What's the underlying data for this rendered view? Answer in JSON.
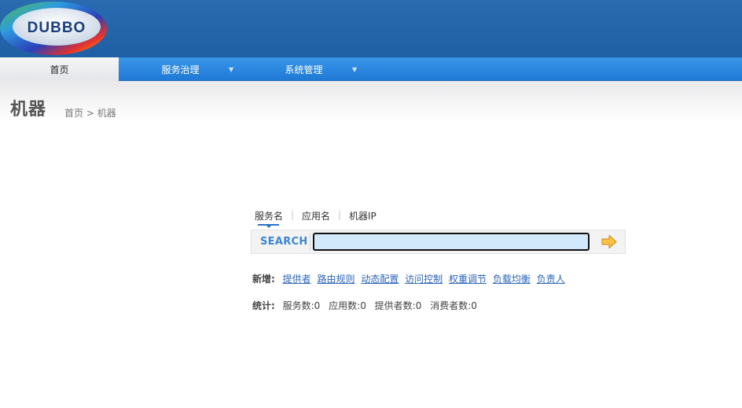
{
  "header": {
    "logo_text": "DUBBO"
  },
  "nav": {
    "items": [
      {
        "label": "首页",
        "active": true
      },
      {
        "label": "服务治理",
        "has_dropdown": true
      },
      {
        "label": "系统管理",
        "has_dropdown": true
      }
    ],
    "dropdown_glyph": "▼"
  },
  "page": {
    "title": "机器",
    "breadcrumb": {
      "home": "首页",
      "separator": " > ",
      "current": "机器"
    }
  },
  "search": {
    "tabs": [
      "服务名",
      "应用名",
      "机器IP"
    ],
    "tab_separator": "|",
    "active_tab": "服务名",
    "label": "SEARCH",
    "value": "",
    "go_icon": "arrow-right-icon"
  },
  "add": {
    "label": "新增:",
    "links": [
      "提供者",
      "路由规则",
      "动态配置",
      "访问控制",
      "权重调节",
      "负载均衡",
      "负责人"
    ]
  },
  "stats": {
    "label": "统计:",
    "items": [
      "服务数:0",
      "应用数:0",
      "提供者数:0",
      "消费者数:0"
    ]
  },
  "colors": {
    "header_bg": "#1f5fa4",
    "nav_bg": "#2a87de",
    "link": "#2b64b5",
    "search_label": "#3b86d1",
    "search_input_bg": "#d2e9fb",
    "arrow": "#f3b523"
  }
}
